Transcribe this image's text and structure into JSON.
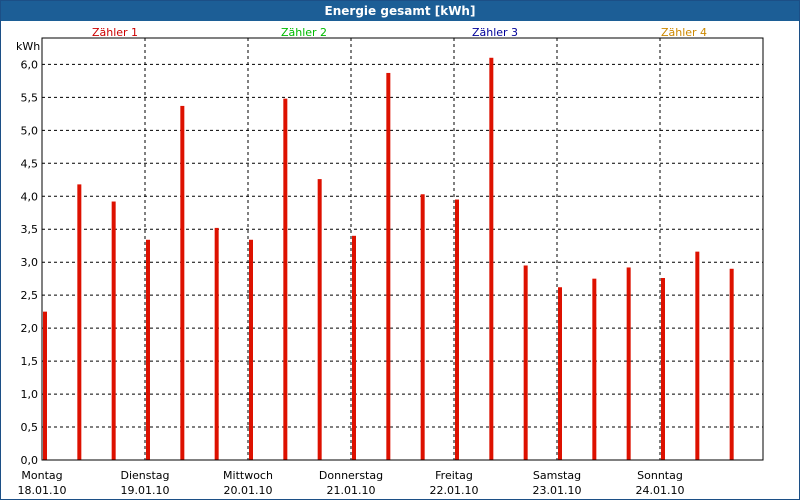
{
  "window": {
    "title": "Energie gesamt [kWh]"
  },
  "legend": [
    {
      "label": "Zähler 1",
      "color": "#cc0000"
    },
    {
      "label": "Zähler 2",
      "color": "#00bb00"
    },
    {
      "label": "Zähler 3",
      "color": "#000099"
    },
    {
      "label": "Zähler 4",
      "color": "#cc8800"
    }
  ],
  "chart_data": {
    "type": "bar",
    "ylabel": "kWh",
    "ylim": [
      0,
      6.4
    ],
    "yticks": [
      "0,0",
      "0,5",
      "1,0",
      "1,5",
      "2,0",
      "2,5",
      "3,0",
      "3,5",
      "4,0",
      "4,5",
      "5,0",
      "5,5",
      "6,0"
    ],
    "grid": true,
    "days": [
      {
        "name": "Montag",
        "date": "18.01.10"
      },
      {
        "name": "Dienstag",
        "date": "19.01.10"
      },
      {
        "name": "Mittwoch",
        "date": "20.01.10"
      },
      {
        "name": "Donnerstag",
        "date": "21.01.10"
      },
      {
        "name": "Freitag",
        "date": "22.01.10"
      },
      {
        "name": "Samstag",
        "date": "23.01.10"
      },
      {
        "name": "Sonntag",
        "date": "24.01.10"
      }
    ],
    "series": [
      {
        "color": "#dd1100",
        "values": [
          2.25,
          4.18,
          3.92,
          3.34,
          5.37,
          3.52,
          3.34,
          5.48,
          4.26,
          3.4,
          5.87,
          4.03,
          3.95,
          6.1,
          2.95,
          2.62,
          2.75,
          2.92,
          2.76,
          3.16,
          2.9
        ]
      }
    ]
  }
}
